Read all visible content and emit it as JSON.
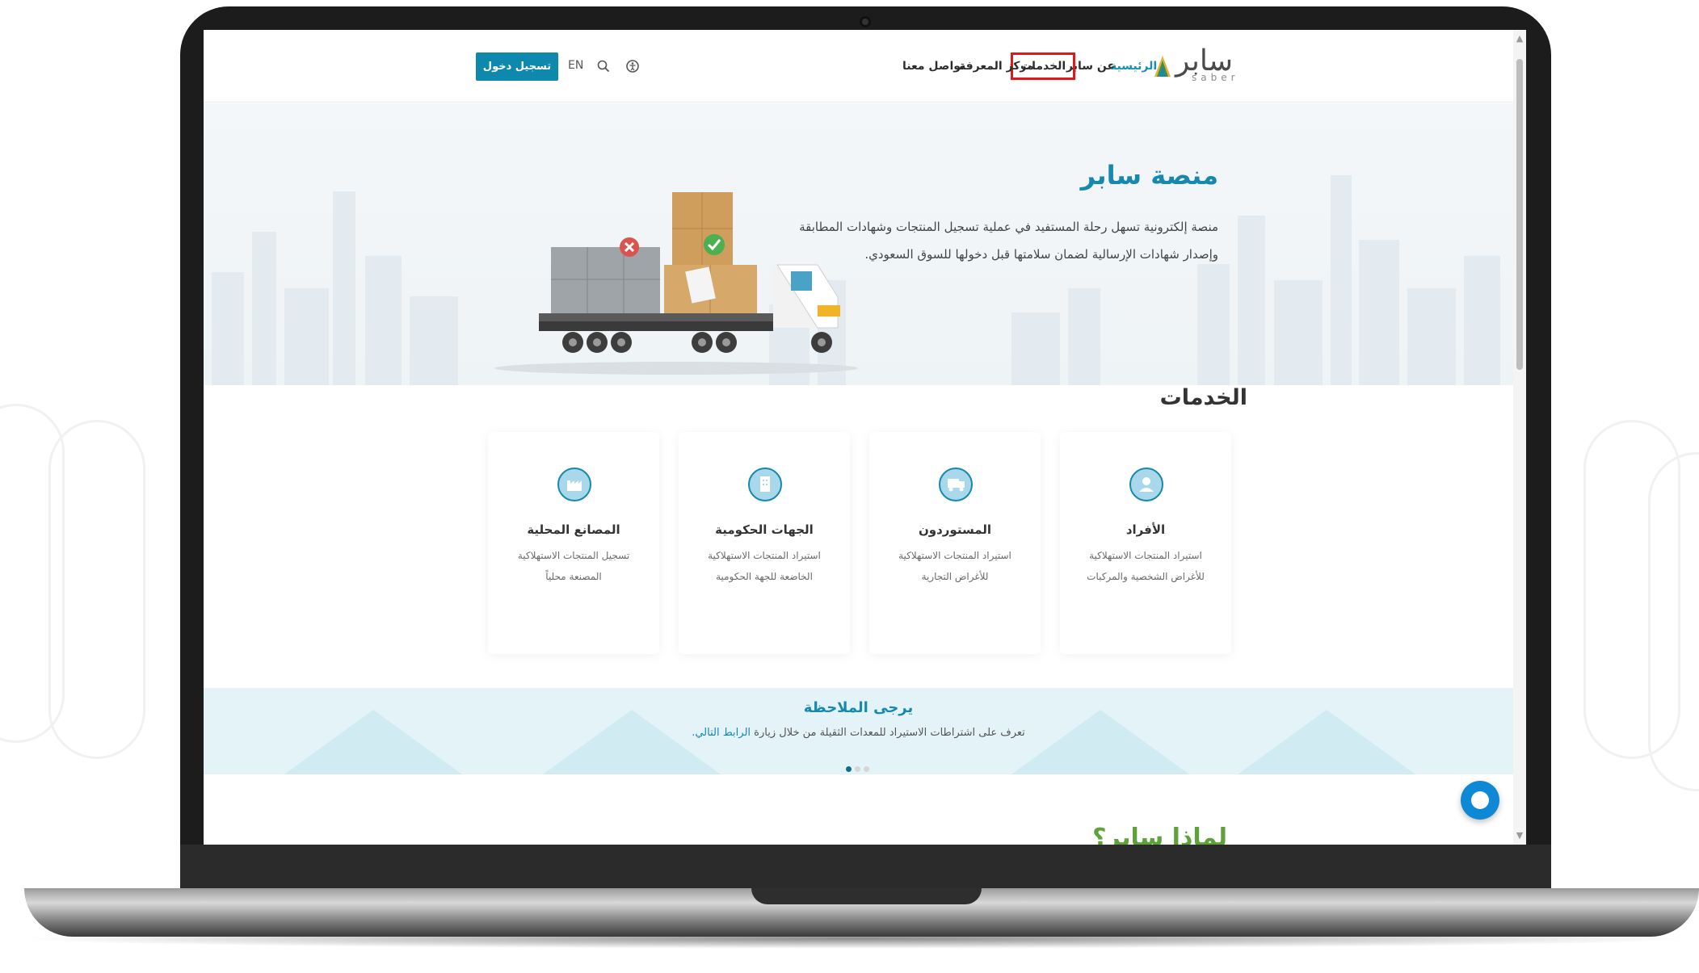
{
  "colors": {
    "primary": "#0f88ad",
    "title_blue": "#1689ad",
    "highlight_red": "#e01818",
    "green": "#5fa23a"
  },
  "header": {
    "logo_text": "سابر",
    "logo_sub": "saber",
    "nav": {
      "home": "الرئيسية",
      "about": "عن سابر",
      "services": "الخدمات",
      "knowledge": "مركز المعرفة",
      "contact": "تواصل معنا"
    },
    "lang": "EN",
    "login": "تسجيل دخول",
    "icons": [
      "accessibility-icon",
      "search-icon"
    ]
  },
  "hero": {
    "title": "منصة سابر",
    "description": "منصة إلكترونية تسهل رحلة المستفيد في عملية تسجيل المنتجات وشهادات المطابقة وإصدار شهادات الإرسالية لضمان سلامتها قبل دخولها للسوق السعودي."
  },
  "services": {
    "title": "الخدمات",
    "cards": [
      {
        "title": "الأفراد",
        "desc": "استيراد المنتجات الاستهلاكية للأغراض الشخصية والمركبات",
        "icon": "person-icon"
      },
      {
        "title": "المستوردون",
        "desc": "استيراد المنتجات الاستهلاكية للأغراض التجارية",
        "icon": "truck-icon"
      },
      {
        "title": "الجهات الحكومية",
        "desc": "استيراد المنتجات الاستهلاكية الخاضعة للجهة الحكومية",
        "icon": "building-icon"
      },
      {
        "title": "المصانع المحلية",
        "desc": "تسجيل المنتجات الاستهلاكية المصنعة محلياً",
        "icon": "factory-icon"
      }
    ]
  },
  "notice": {
    "title": "يرجى الملاحظة",
    "text": "تعرف على اشتراطات الاستيراد للمعدات الثقيلة من خلال زيارة",
    "link": "الرابط التالي."
  },
  "why": {
    "title": "لماذا سابر؟"
  }
}
